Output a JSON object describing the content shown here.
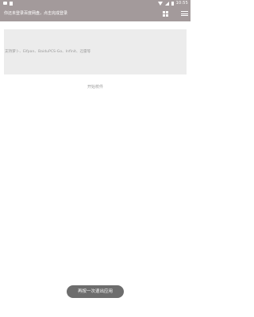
{
  "status_bar": {
    "time": "10:55",
    "icons": [
      "notification-icon",
      "sim-icon",
      "wifi-icon",
      "signal-icon",
      "battery-icon"
    ]
  },
  "app_bar": {
    "title": "你还未登录百度网盘，点击完成登录",
    "grid_icon": "grid-icon",
    "menu_icon": "menu-icon"
  },
  "main": {
    "input_hint": "支持萝卜、Eifpan、BaiduPCS-Go、Infinit、迅雷等",
    "start_button_label": "开始校件"
  },
  "toast": {
    "text": "再按一次退出应用"
  },
  "colors": {
    "app_bar_bg": "#a39a9b",
    "input_bg": "#ececec",
    "toast_bg": "#6d6d6d"
  }
}
